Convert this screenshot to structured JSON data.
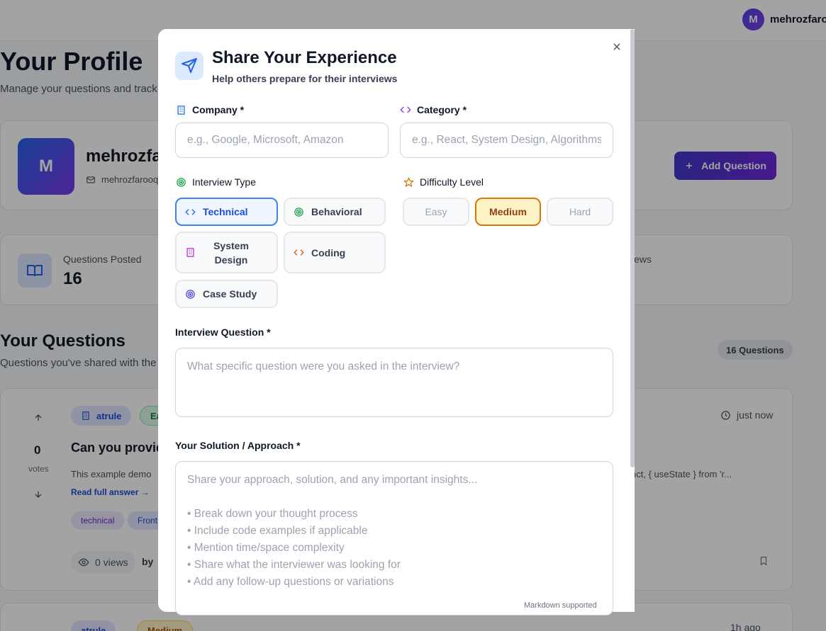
{
  "background": {
    "user": {
      "initial": "M",
      "name": "mehrozfarooq"
    },
    "page_title": "Your Profile",
    "page_subtitle": "Manage your questions and track",
    "profile": {
      "initial": "M",
      "name": "mehrozfarooq",
      "email": "mehrozfarooq"
    },
    "add_question_label": "Add Question",
    "stats": {
      "posted_label": "Questions Posted",
      "posted_value": "16",
      "views_label": "iews"
    },
    "questions_title": "Your Questions",
    "questions_subtitle": "Questions you've shared with the",
    "questions_count": "16 Questions",
    "question": {
      "votes": "0",
      "votes_label": "votes",
      "company": "atrule",
      "difficulty": "Easy",
      "time": "just now",
      "title": "Can you provide",
      "excerpt": "This example demo",
      "code_excerpt": "nct, { useState } from 'r...",
      "read_more": "Read full answer →",
      "tags": [
        "technical",
        "Front"
      ],
      "views": "0 views",
      "by": "by"
    },
    "question_2": {
      "company": "atrule",
      "difficulty": "Medium",
      "time": "1h ago"
    }
  },
  "modal": {
    "title": "Share Your Experience",
    "subtitle": "Help others prepare for their interviews",
    "company": {
      "label": "Company *",
      "placeholder": "e.g., Google, Microsoft, Amazon",
      "value": ""
    },
    "category": {
      "label": "Category *",
      "placeholder": "e.g., React, System Design, Algorithms",
      "value": ""
    },
    "interview_type": {
      "label": "Interview Type",
      "selected": "Technical",
      "options": [
        "Technical",
        "Behavioral",
        "System Design",
        "Coding",
        "Case Study"
      ]
    },
    "difficulty": {
      "label": "Difficulty Level",
      "selected": "Medium",
      "options": [
        "Easy",
        "Medium",
        "Hard"
      ]
    },
    "question": {
      "label": "Interview Question *",
      "placeholder": "What specific question were you asked in the interview?",
      "value": ""
    },
    "solution": {
      "label": "Your Solution / Approach *",
      "placeholder": "Share your approach, solution, and any important insights...\n\n• Break down your thought process\n• Include code examples if applicable\n• Mention time/space complexity\n• Share what the interviewer was looking for\n• Add any follow-up questions or variations",
      "value": "",
      "note": "Markdown supported"
    }
  },
  "colors": {
    "accent": "#2563eb",
    "brand_gradient_start": "#4338ca",
    "brand_gradient_end": "#6d28d9",
    "medium": "#d97706"
  },
  "icons": {
    "close": "close-icon",
    "header": "send-icon",
    "company": "building-icon",
    "category": "code-icon",
    "interview_type": "target-icon",
    "difficulty": "star-icon"
  }
}
